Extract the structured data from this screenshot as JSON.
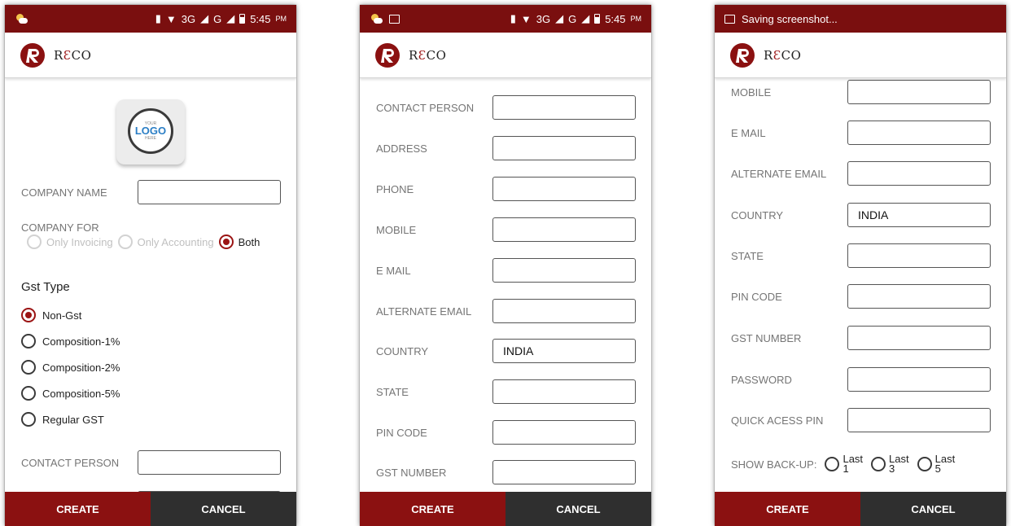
{
  "colors": {
    "primary": "#8b1111",
    "status_bar": "#7a0f0f",
    "cancel_bg": "#2f2f2f",
    "radio_selected": "#9b1414"
  },
  "brand": {
    "r": "R",
    "e": "Ɛ",
    "co": "CO"
  },
  "status": {
    "time": "5:45",
    "ampm": "PM",
    "network": "3G",
    "saving": "Saving screenshot..."
  },
  "logo_placeholder": {
    "top": "YOUR",
    "main": "LOGO",
    "bottom": "HERE"
  },
  "screen1": {
    "company_name_label": "COMPANY NAME",
    "company_for_label": "COMPANY FOR",
    "company_for_options": [
      "Only Invoicing",
      "Only Accounting",
      "Both"
    ],
    "company_for_selected": "Both",
    "gst_type_heading": "Gst Type",
    "gst_options": [
      "Non-Gst",
      "Composition-1%",
      "Composition-2%",
      "Composition-5%",
      "Regular GST"
    ],
    "gst_selected": "Non-Gst",
    "contact_person_label": "CONTACT PERSON"
  },
  "screen2": {
    "fields": [
      {
        "label": "CONTACT PERSON",
        "value": ""
      },
      {
        "label": "ADDRESS",
        "value": ""
      },
      {
        "label": "PHONE",
        "value": ""
      },
      {
        "label": "MOBILE",
        "value": ""
      },
      {
        "label": "E MAIL",
        "value": ""
      },
      {
        "label": "ALTERNATE EMAIL",
        "value": ""
      },
      {
        "label": "COUNTRY",
        "value": "INDIA"
      },
      {
        "label": "STATE",
        "value": ""
      },
      {
        "label": "PIN CODE",
        "value": ""
      },
      {
        "label": "GST NUMBER",
        "value": ""
      }
    ]
  },
  "screen3": {
    "fields": [
      {
        "label": "MOBILE",
        "value": ""
      },
      {
        "label": "E MAIL",
        "value": ""
      },
      {
        "label": "ALTERNATE EMAIL",
        "value": ""
      },
      {
        "label": "COUNTRY",
        "value": "INDIA"
      },
      {
        "label": "STATE",
        "value": ""
      },
      {
        "label": "PIN CODE",
        "value": ""
      },
      {
        "label": "GST NUMBER",
        "value": ""
      },
      {
        "label": "PASSWORD",
        "value": ""
      },
      {
        "label": "QUICK ACESS PIN",
        "value": ""
      }
    ],
    "backup_label": "SHOW BACK-UP:",
    "backup_options": [
      {
        "word": "Last",
        "num": "1"
      },
      {
        "word": "Last",
        "num": "3"
      },
      {
        "word": "Last",
        "num": "5"
      }
    ]
  },
  "buttons": {
    "create": "CREATE",
    "cancel": "CANCEL"
  }
}
